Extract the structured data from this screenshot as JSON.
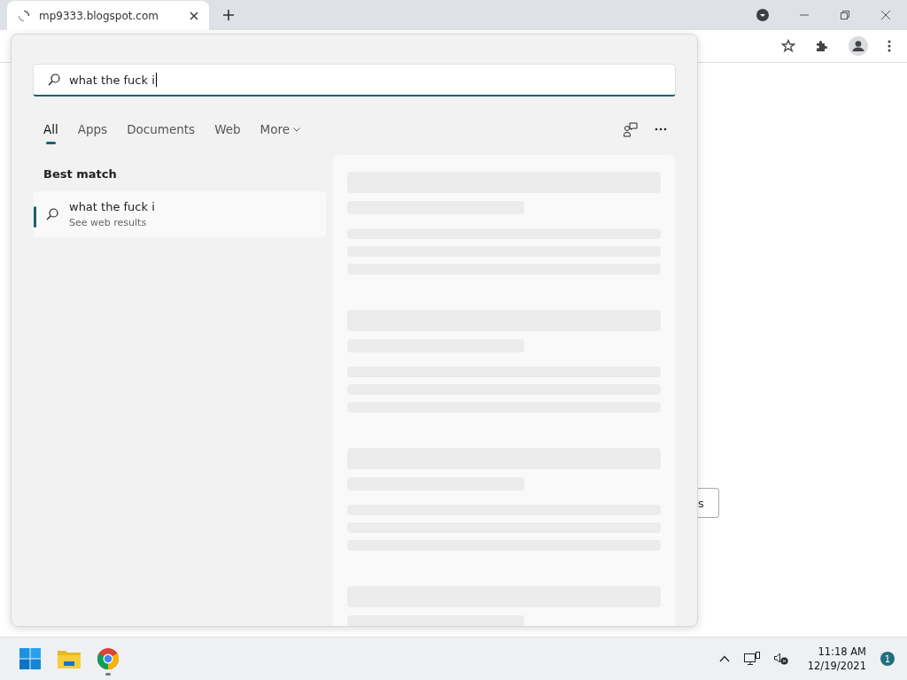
{
  "browser": {
    "tabs": [
      {
        "title": "mp9333.blogspot.com",
        "selected": true,
        "loading": true
      }
    ]
  },
  "page": {
    "button_label": "s"
  },
  "search": {
    "query": "what the fuck i",
    "filters": [
      {
        "label": "All",
        "selected": true
      },
      {
        "label": "Apps",
        "selected": false
      },
      {
        "label": "Documents",
        "selected": false
      },
      {
        "label": "Web",
        "selected": false
      },
      {
        "label": "More",
        "selected": false,
        "dropdown": true
      }
    ],
    "best_match_heading": "Best match",
    "results": [
      {
        "title": "what the fuck i",
        "subtitle": "See web results",
        "selected": true
      }
    ]
  },
  "taskbar": {
    "apps": [
      {
        "kind": "start",
        "running": false
      },
      {
        "kind": "explorer",
        "running": false
      },
      {
        "kind": "chrome",
        "running": true
      }
    ],
    "time": "11:18 AM",
    "date": "12/19/2021",
    "notifications": "1"
  }
}
